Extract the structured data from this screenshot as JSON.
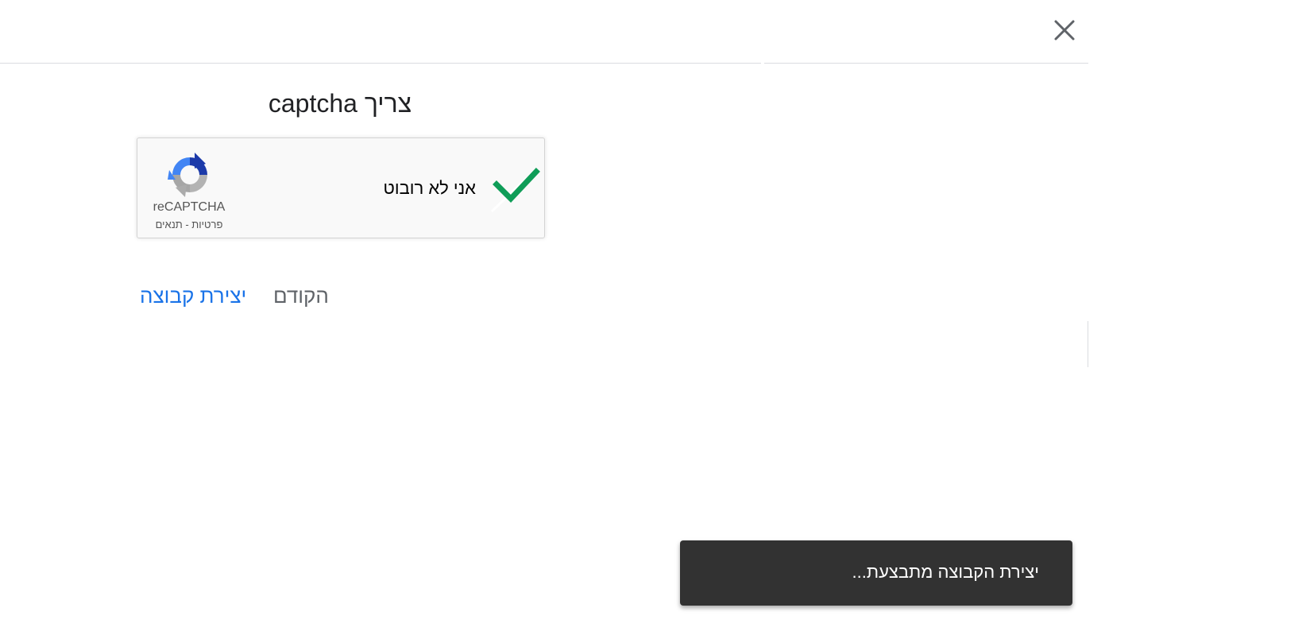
{
  "dialog": {
    "close_icon": "close-icon",
    "title": "צריך captcha"
  },
  "recaptcha": {
    "checkbox_state": "checked",
    "checkbox_icon": "checkmark-icon",
    "label": "אני לא רובוט",
    "brand": "reCAPTCHA",
    "links": "פרטיות - תנאים",
    "logo_icon": "recaptcha-logo-icon",
    "check_color": "#0f9d58"
  },
  "actions": {
    "back_label": "הקודם",
    "create_label": "יצירת קבוצה",
    "accent_color": "#1a73e8"
  },
  "snackbar": {
    "message": "יצירת הקבוצה מתבצעת..."
  }
}
